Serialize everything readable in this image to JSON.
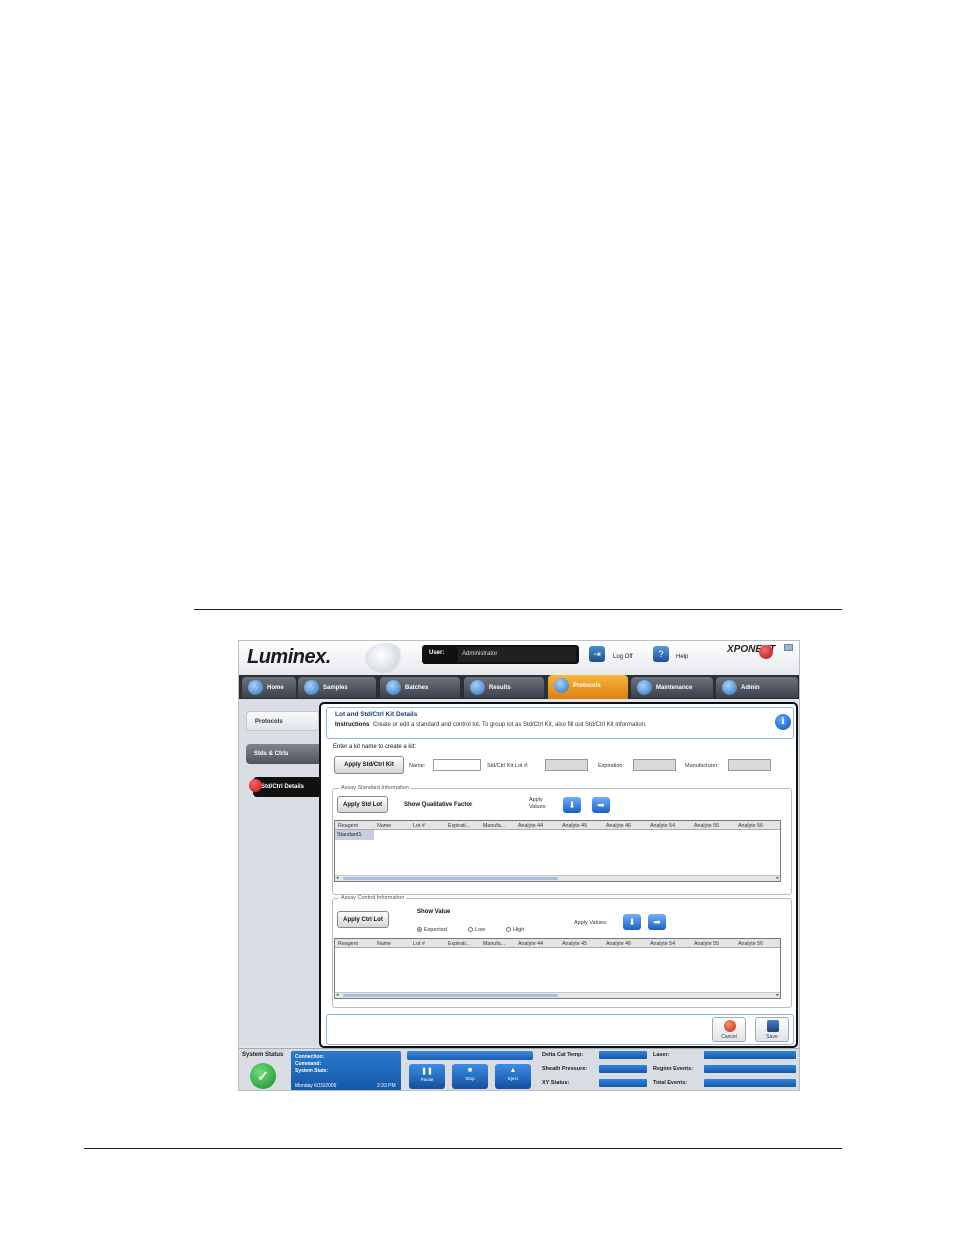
{
  "app": {
    "logo": "Luminex.",
    "brand": "XPONENT",
    "user_label": "User:",
    "user_value": "Administrator",
    "logoff_label": "Log Off",
    "help_label": "Help"
  },
  "tabs": [
    {
      "label": "Home"
    },
    {
      "label": "Samples"
    },
    {
      "label": "Batches"
    },
    {
      "label": "Results"
    },
    {
      "label": "Protocols",
      "active": true
    },
    {
      "label": "Maintenance"
    },
    {
      "label": "Admin"
    }
  ],
  "nav": {
    "protocols": "Protocols",
    "stds": "Stds & Ctrls",
    "details": "Std/Ctrl Details"
  },
  "panel": {
    "title": "Lot and Std/Ctrl Kit Details",
    "instructions_label": "Instructions",
    "instructions_text": "Create or edit a standard and control lot.  To group lot as Std/Ctrl Kit, also fill out Std/Ctrl Kit information.",
    "prompt": "Enter a kit name to create a kit:",
    "apply_kit_button": "Apply Std/Ctrl Kit",
    "name_label": "Name:",
    "kit_lot_label": "Std/Ctrl Kit Lot #:",
    "expiration_label": "Expiration:",
    "manufacturer_label": "Manufacturer:"
  },
  "standard": {
    "legend": "Assay Standard Information",
    "apply_lot_button": "Apply Std Lot",
    "show_qual": "Show Qualitative Factor",
    "apply_values_label": "Apply Values:",
    "columns": [
      "Reagent",
      "Name",
      "Lot #",
      "Expirati...",
      "Manufa...",
      "Analyte 44",
      "Analyte 45",
      "Analyte 46",
      "Analyte 54",
      "Analyte 55",
      "Analyte 56"
    ],
    "rows": [
      [
        "Standard1"
      ]
    ]
  },
  "control": {
    "legend": "Assay Control Information",
    "apply_lot_button": "Apply Ctrl Lot",
    "show_value": "Show Value",
    "radio_expected": "Expected",
    "radio_low": "Low",
    "radio_high": "High",
    "apply_values_label": "Apply Values:",
    "columns": [
      "Reagent",
      "Name",
      "Lot #",
      "Expirati...",
      "Manufa...",
      "Analyte 44",
      "Analyte 45",
      "Analyte 46",
      "Analyte 54",
      "Analyte 55",
      "Analyte 56"
    ]
  },
  "footer": {
    "cancel": "Cancel",
    "save": "Save"
  },
  "status": {
    "title": "System Status",
    "connection": "Connection:",
    "command": "Command:",
    "system_state": "System State:",
    "date": "Monday 6/15/2009",
    "time": "2:33 PM",
    "pause": "Pause",
    "stop": "Stop",
    "eject": "Eject",
    "delta_cal_temp": "Delta Cal Temp:",
    "sheath_pressure": "Sheath Pressure:",
    "xy_status": "XY Status:",
    "laser": "Laser:",
    "region_events": "Region Events:",
    "total_events": "Total Events:"
  }
}
